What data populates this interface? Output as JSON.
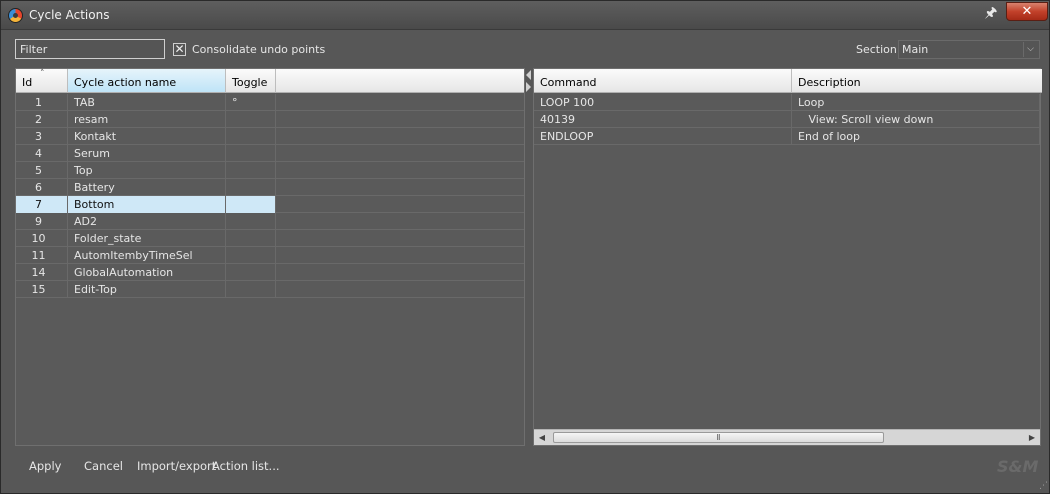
{
  "window": {
    "title": "Cycle Actions"
  },
  "toolbar": {
    "filter_placeholder": "Filter",
    "consolidate_label": "Consolidate undo points",
    "consolidate_checked": true,
    "section_label": "Section:",
    "section_value": "Main"
  },
  "left_table": {
    "columns": [
      "Id",
      "Cycle action name",
      "Toggle"
    ],
    "selected_id": "7",
    "rows": [
      {
        "id": "1",
        "name": "TAB",
        "toggle": "°"
      },
      {
        "id": "2",
        "name": "resam",
        "toggle": ""
      },
      {
        "id": "3",
        "name": "Kontakt",
        "toggle": ""
      },
      {
        "id": "4",
        "name": "Serum",
        "toggle": ""
      },
      {
        "id": "5",
        "name": "Top",
        "toggle": ""
      },
      {
        "id": "6",
        "name": "Battery",
        "toggle": ""
      },
      {
        "id": "7",
        "name": "Bottom",
        "toggle": ""
      },
      {
        "id": "9",
        "name": "AD2",
        "toggle": ""
      },
      {
        "id": "10",
        "name": "Folder_state",
        "toggle": ""
      },
      {
        "id": "11",
        "name": "AutomItembyTimeSel",
        "toggle": ""
      },
      {
        "id": "14",
        "name": "GlobalAutomation",
        "toggle": ""
      },
      {
        "id": "15",
        "name": "Edit-Top",
        "toggle": ""
      }
    ]
  },
  "right_table": {
    "columns": [
      "Command",
      "Description"
    ],
    "rows": [
      {
        "command": "LOOP 100",
        "description": "Loop"
      },
      {
        "command": "40139",
        "description": "   View: Scroll view down"
      },
      {
        "command": "ENDLOOP",
        "description": "End of loop"
      }
    ]
  },
  "footer": {
    "apply": "Apply",
    "cancel": "Cancel",
    "import_export": "Import/export",
    "action_list": "Action list...",
    "brand": "S&M"
  },
  "colors": {
    "background": "#575757",
    "selection": "#cfe8f7",
    "header_active": "#bfe4f7",
    "close_button": "#c2412a"
  }
}
